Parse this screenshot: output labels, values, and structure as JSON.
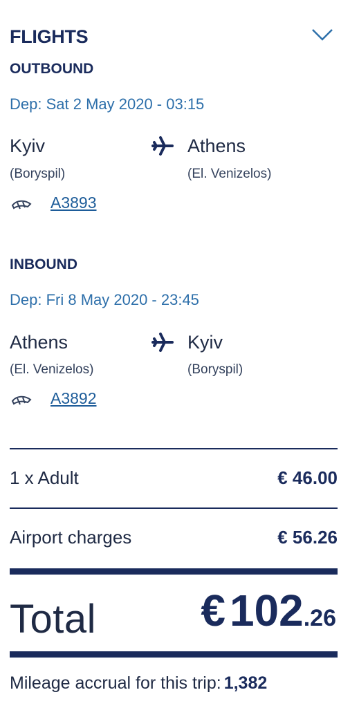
{
  "flights": {
    "title": "FLIGHTS",
    "collapse_icon": "chevron-down-icon",
    "outbound": {
      "title": "OUTBOUND",
      "departure": "Dep: Sat 2 May 2020 - 03:15",
      "from_city": "Kyiv",
      "from_airport": "(Boryspil)",
      "to_city": "Athens",
      "to_airport": "(El. Venizelos)",
      "flight_number": "A3893"
    },
    "inbound": {
      "title": "INBOUND",
      "departure": "Dep: Fri 8 May 2020 - 23:45",
      "from_city": "Athens",
      "from_airport": "(El. Venizelos)",
      "to_city": "Kyiv",
      "to_airport": "(Boryspil)",
      "flight_number": "A3892"
    }
  },
  "pricing": {
    "adult_label": "1 x Adult",
    "adult_price": "€ 46.00",
    "charges_label": "Airport charges",
    "charges_price": "€ 56.26",
    "total_label": "Total",
    "total_currency": "€",
    "total_integer": "102",
    "total_decimal": ".26"
  },
  "mileage": {
    "label": "Mileage accrual for this trip:",
    "value": "1,382"
  },
  "colors": {
    "navy": "#1a2b5c",
    "link_blue": "#2d6faa"
  }
}
